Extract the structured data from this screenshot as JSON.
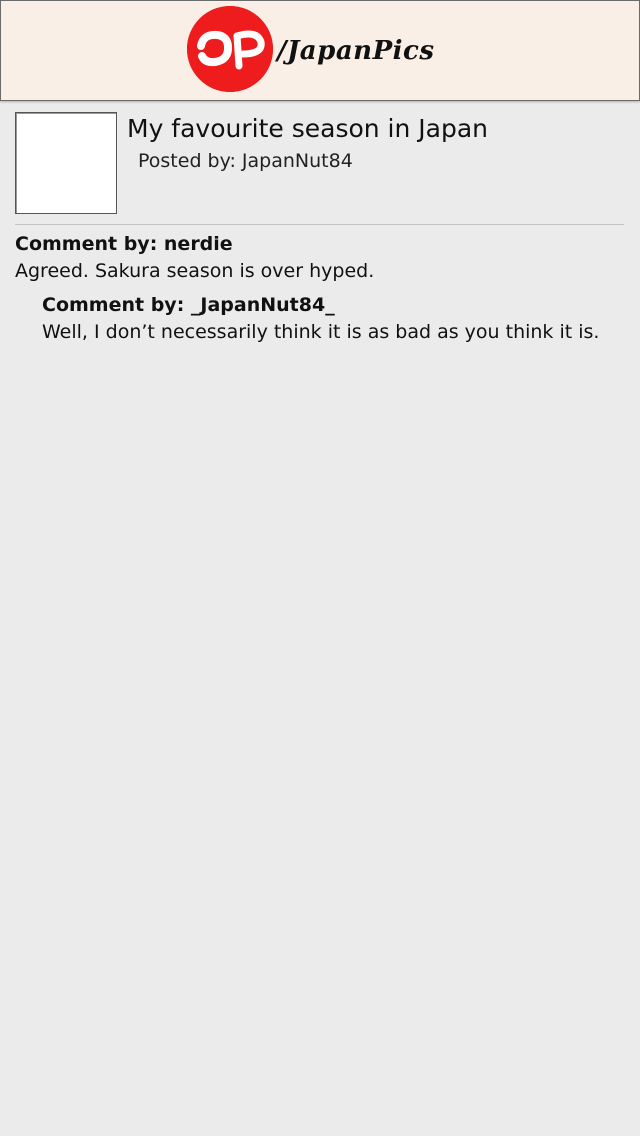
{
  "header": {
    "logo_icon": "jp-red-circle-logo",
    "logo_text": "/JapanPics",
    "colors": {
      "background": "#f9efe6",
      "logo_red": "#ee1c1c"
    }
  },
  "post": {
    "title": "My favourite season in Japan",
    "author": "Posted by: JapanNut84"
  },
  "comments": [
    {
      "header": "Comment by: nerdie",
      "body": "Agreed. Sakura season is over hyped."
    },
    {
      "header": "Comment by: _JapanNut84_",
      "body": "Well, I don’t necessarily think it is as bad as you think it is."
    }
  ],
  "colors": {
    "page_background": "#ebebeb"
  }
}
